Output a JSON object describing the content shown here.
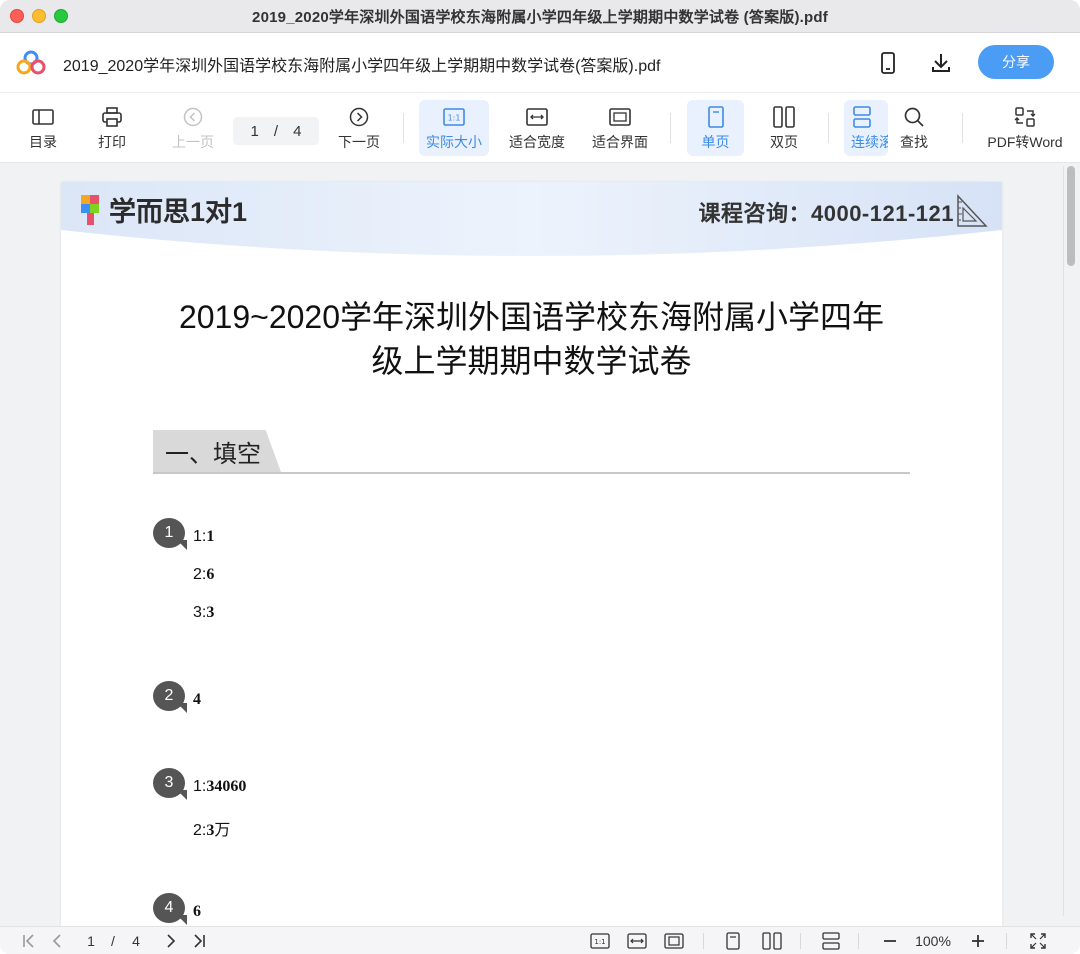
{
  "window": {
    "title": "2019_2020学年深圳外国语学校东海附属小学四年级上学期期中数学试卷 (答案版).pdf"
  },
  "header": {
    "file_name": "2019_2020学年深圳外国语学校东海附属小学四年级上学期期中数学试卷(答案版).pdf",
    "share_label": "分享",
    "icons": [
      "mobile-icon",
      "download-icon"
    ],
    "accent_color": "#4b9cf5"
  },
  "toolbar": {
    "toc": "目录",
    "print": "打印",
    "prev": "上一页",
    "page_current": "1",
    "page_sep": "/",
    "page_total": "4",
    "next": "下一页",
    "actual_size": "实际大小",
    "fit_width": "适合宽度",
    "fit_page": "适合界面",
    "single_page": "单页",
    "double_page": "双页",
    "continuous": "连续滚",
    "find": "查找",
    "pdf_to_word": "PDF转Word"
  },
  "document": {
    "brand": "学而思1对1",
    "consult": "课程咨询：4000-121-121",
    "title_line1": "2019~2020学年深圳外国语学校东海附属小学四年",
    "title_line2": "级上学期期中数学试卷",
    "section": "一、填空",
    "questions": [
      {
        "num": "1",
        "answers": [
          {
            "prefix": "1:",
            "value": "1"
          },
          {
            "prefix": "2:",
            "value": "6"
          },
          {
            "prefix": "3:",
            "value": "3"
          }
        ]
      },
      {
        "num": "2",
        "answers": [
          {
            "prefix": "",
            "value": "4"
          }
        ]
      },
      {
        "num": "3",
        "answers": [
          {
            "prefix": "1:",
            "value": "34060"
          },
          {
            "prefix": "2:",
            "value": "3",
            "suffix": "万"
          }
        ]
      },
      {
        "num": "4",
        "answers": [
          {
            "prefix": "",
            "value": "6"
          }
        ]
      }
    ]
  },
  "bottombar": {
    "page_current": "1",
    "page_sep": "/",
    "page_total": "4",
    "zoom": "100%"
  }
}
